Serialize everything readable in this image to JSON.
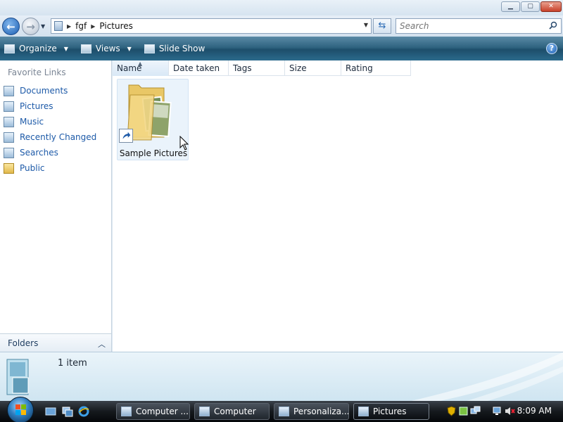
{
  "window": {
    "caption_buttons": [
      "minimize",
      "maximize",
      "close"
    ]
  },
  "address": {
    "crumbs": [
      "fgf",
      "Pictures"
    ],
    "search_placeholder": "Search"
  },
  "toolbar": {
    "organize": "Organize",
    "views": "Views",
    "slideshow": "Slide Show"
  },
  "nav": {
    "favorites_title": "Favorite Links",
    "items": [
      {
        "label": "Documents",
        "icon": "documents-icon"
      },
      {
        "label": "Pictures",
        "icon": "pictures-icon"
      },
      {
        "label": "Music",
        "icon": "music-icon"
      },
      {
        "label": "Recently Changed",
        "icon": "recently-changed-icon"
      },
      {
        "label": "Searches",
        "icon": "searches-icon"
      },
      {
        "label": "Public",
        "icon": "public-folder-icon"
      }
    ],
    "folders_label": "Folders"
  },
  "columns": [
    "Name",
    "Date taken",
    "Tags",
    "Size",
    "Rating"
  ],
  "files": [
    {
      "name": "Sample Pictures",
      "icon": "shortcut-folder-icon"
    }
  ],
  "details": {
    "count": "1 item"
  },
  "taskbar": {
    "tasks": [
      "Computer ...",
      "Computer",
      "Personaliza...",
      "Pictures"
    ],
    "clock": "8:09 AM"
  }
}
